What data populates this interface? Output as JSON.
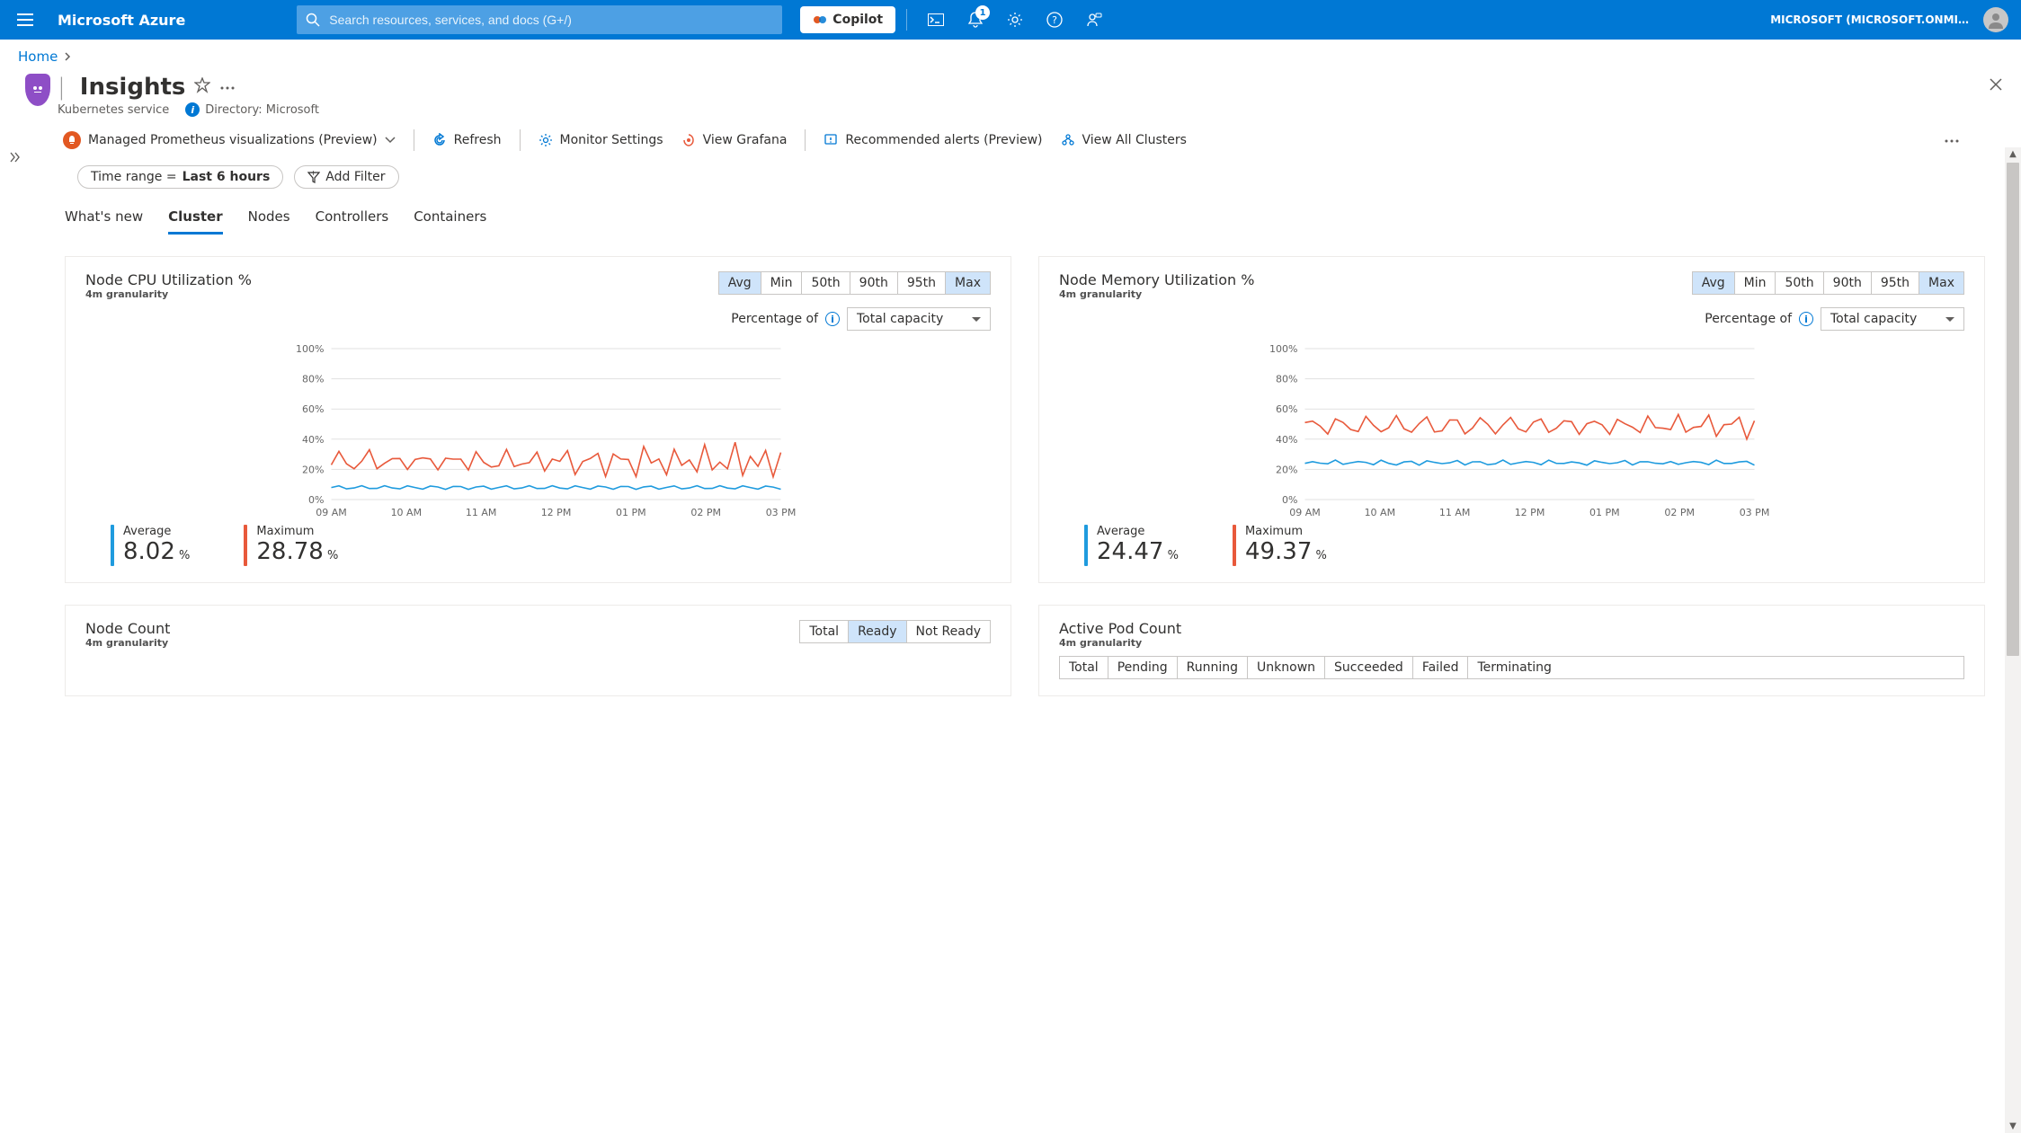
{
  "topbar": {
    "brand": "Microsoft Azure",
    "search_placeholder": "Search resources, services, and docs (G+/)",
    "copilot_label": "Copilot",
    "notification_count": "1",
    "tenant_label": "MICROSOFT (MICROSOFT.ONMI…"
  },
  "breadcrumb": {
    "items": [
      "Home"
    ]
  },
  "header": {
    "separator": "|",
    "title": "Insights",
    "subtitle_service": "Kubernetes service",
    "directory_label": "Directory: Microsoft"
  },
  "toolbar": {
    "prometheus": "Managed Prometheus visualizations (Preview)",
    "refresh": "Refresh",
    "monitor_settings": "Monitor Settings",
    "view_grafana": "View Grafana",
    "recommended_alerts": "Recommended alerts (Preview)",
    "view_all_clusters": "View All Clusters"
  },
  "filters": {
    "time_range_label": "Time range = ",
    "time_range_value": "Last 6 hours",
    "add_filter": "Add Filter"
  },
  "tabs": {
    "items": [
      "What's new",
      "Cluster",
      "Nodes",
      "Controllers",
      "Containers"
    ],
    "active": "Cluster"
  },
  "chart_common": {
    "granularity": "4m granularity",
    "agg_options": [
      "Avg",
      "Min",
      "50th",
      "90th",
      "95th",
      "Max"
    ],
    "pct_label": "Percentage of",
    "total_cap": "Total capacity",
    "x_ticks": [
      "09 AM",
      "10 AM",
      "11 AM",
      "12 PM",
      "01 PM",
      "02 PM",
      "03 PM"
    ]
  },
  "cpu_chart": {
    "title": "Node CPU Utilization %",
    "sel": [
      "Avg",
      "Max"
    ],
    "legend_avg_name": "Average",
    "legend_avg_val": "8.02",
    "legend_max_name": "Maximum",
    "legend_max_val": "28.78"
  },
  "mem_chart": {
    "title": "Node Memory Utilization %",
    "sel": [
      "Avg",
      "Max"
    ],
    "legend_avg_name": "Average",
    "legend_avg_val": "24.47",
    "legend_max_name": "Maximum",
    "legend_max_val": "49.37"
  },
  "node_count_chart": {
    "title": "Node Count",
    "agg_options": [
      "Total",
      "Ready",
      "Not Ready"
    ],
    "sel": [
      "Ready"
    ]
  },
  "pod_count_chart": {
    "title": "Active Pod Count",
    "agg_options": [
      "Total",
      "Pending",
      "Running",
      "Unknown",
      "Succeeded",
      "Failed",
      "Terminating"
    ],
    "sel": []
  },
  "chart_data": [
    {
      "type": "line",
      "title": "Node CPU Utilization %",
      "x_ticks": [
        "09 AM",
        "10 AM",
        "11 AM",
        "12 PM",
        "01 PM",
        "02 PM",
        "03 PM"
      ],
      "ylabel": "%",
      "ylim": [
        0,
        100
      ],
      "y_ticks": [
        0,
        20,
        40,
        60,
        80,
        100
      ],
      "series": [
        {
          "name": "Average",
          "color": "#1f9bde",
          "values": [
            8,
            8,
            8,
            8,
            8,
            8,
            8,
            8,
            8,
            8,
            8,
            8
          ]
        },
        {
          "name": "Maximum",
          "color": "#e8593b",
          "values": [
            20,
            30,
            22,
            28,
            20,
            32,
            21,
            30,
            20,
            28,
            22,
            30
          ]
        }
      ],
      "summary": {
        "Average": 8.02,
        "Maximum": 28.78
      }
    },
    {
      "type": "line",
      "title": "Node Memory Utilization %",
      "x_ticks": [
        "09 AM",
        "10 AM",
        "11 AM",
        "12 PM",
        "01 PM",
        "02 PM",
        "03 PM"
      ],
      "ylabel": "%",
      "ylim": [
        0,
        100
      ],
      "y_ticks": [
        0,
        20,
        40,
        60,
        80,
        100
      ],
      "series": [
        {
          "name": "Average",
          "color": "#1f9bde",
          "values": [
            24,
            24,
            25,
            24,
            25,
            24,
            25,
            24,
            25,
            24,
            25,
            24
          ]
        },
        {
          "name": "Maximum",
          "color": "#e8593b",
          "values": [
            48,
            50,
            47,
            51,
            48,
            50,
            47,
            51,
            48,
            50,
            47,
            51
          ]
        }
      ],
      "summary": {
        "Average": 24.47,
        "Maximum": 49.37
      }
    }
  ]
}
